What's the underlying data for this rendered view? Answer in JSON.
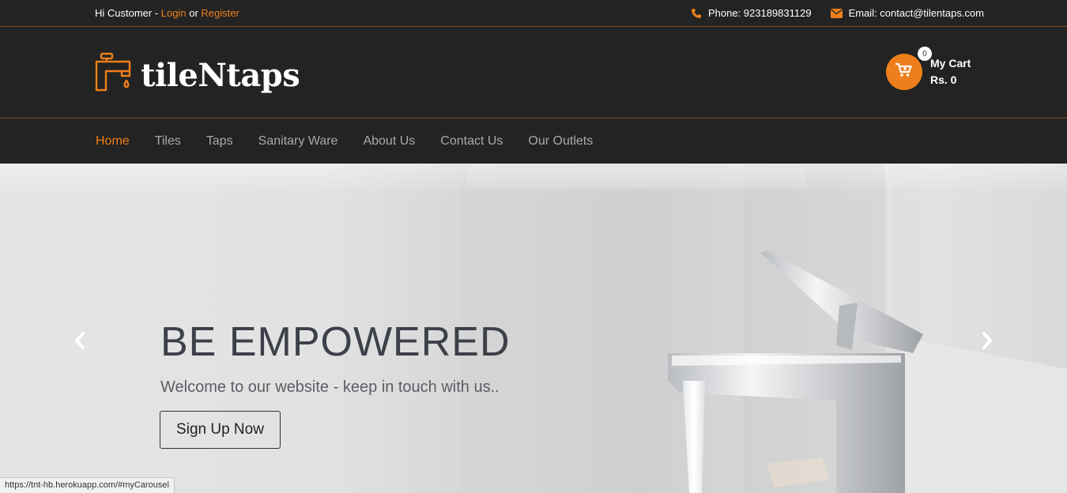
{
  "topbar": {
    "greeting": "Hi Customer - ",
    "login": "Login",
    "or": " or ",
    "register": "Register",
    "phone_label": "Phone: 923189831129",
    "email_label": "Email: contact@tilentaps.com",
    "icons": [
      "phone-icon",
      "envelope-icon"
    ]
  },
  "header": {
    "logo_text": "tileNtaps",
    "cart": {
      "count": "0",
      "title": "My Cart",
      "amount": "Rs. 0"
    }
  },
  "nav": {
    "items": [
      {
        "label": "Home"
      },
      {
        "label": "Tiles"
      },
      {
        "label": "Taps"
      },
      {
        "label": "Sanitary Ware"
      },
      {
        "label": "About Us"
      },
      {
        "label": "Contact Us"
      },
      {
        "label": "Our Outlets"
      }
    ],
    "active": "Home"
  },
  "hero": {
    "title": "BE EMPOWERED",
    "subtitle": "Welcome to our website - keep in touch with us..",
    "button": "Sign Up Now"
  },
  "statusbar": {
    "url": "https://tnt-hb.herokuapp.com/#myCarousel"
  },
  "colors": {
    "accent": "#ef7f1a",
    "dark": "#232323",
    "text_muted": "#a9a9a9"
  }
}
